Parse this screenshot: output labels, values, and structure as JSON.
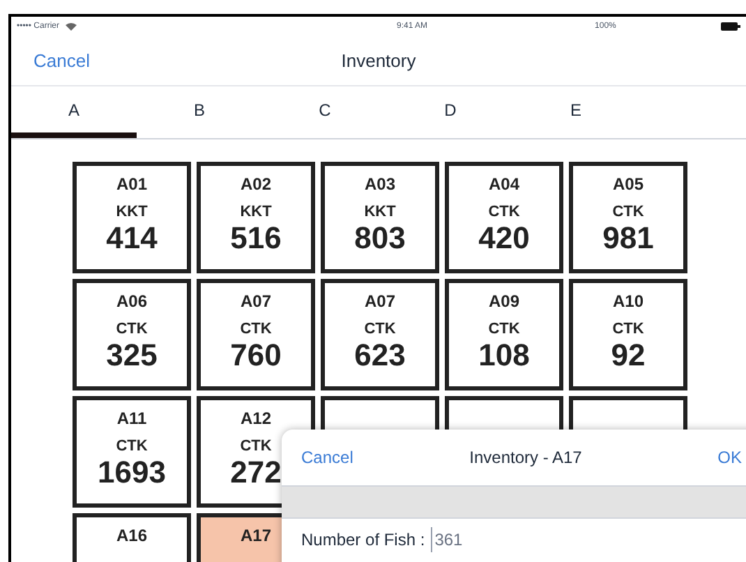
{
  "status_bar": {
    "carrier": "••••• Carrier",
    "time": "9:41 AM",
    "battery": "100%"
  },
  "nav": {
    "cancel": "Cancel",
    "title": "Inventory"
  },
  "tabs": [
    {
      "label": "A",
      "selected": true
    },
    {
      "label": "B",
      "selected": false
    },
    {
      "label": "C",
      "selected": false
    },
    {
      "label": "D",
      "selected": false
    },
    {
      "label": "E",
      "selected": false
    }
  ],
  "cells": [
    {
      "code": "A01",
      "type": "KKT",
      "count": "414",
      "selected": false
    },
    {
      "code": "A02",
      "type": "KKT",
      "count": "516",
      "selected": false
    },
    {
      "code": "A03",
      "type": "KKT",
      "count": "803",
      "selected": false
    },
    {
      "code": "A04",
      "type": "CTK",
      "count": "420",
      "selected": false
    },
    {
      "code": "A05",
      "type": "CTK",
      "count": "981",
      "selected": false
    },
    {
      "code": "A06",
      "type": "CTK",
      "count": "325",
      "selected": false
    },
    {
      "code": "A07",
      "type": "CTK",
      "count": "760",
      "selected": false
    },
    {
      "code": "A07",
      "type": "CTK",
      "count": "623",
      "selected": false
    },
    {
      "code": "A09",
      "type": "CTK",
      "count": "108",
      "selected": false
    },
    {
      "code": "A10",
      "type": "CTK",
      "count": "92",
      "selected": false
    },
    {
      "code": "A11",
      "type": "CTK",
      "count": "1693",
      "selected": false
    },
    {
      "code": "A12",
      "type": "CTK",
      "count": "272",
      "selected": false
    },
    {
      "selected": false
    },
    {
      "selected": false
    },
    {
      "selected": false
    },
    {
      "code": "A16",
      "selected": false
    },
    {
      "code": "A17",
      "selected": true
    }
  ],
  "dialog": {
    "cancel": "Cancel",
    "title": "Inventory - A17",
    "ok": "OK",
    "field_label": "Number of Fish :",
    "placeholder": "361"
  }
}
